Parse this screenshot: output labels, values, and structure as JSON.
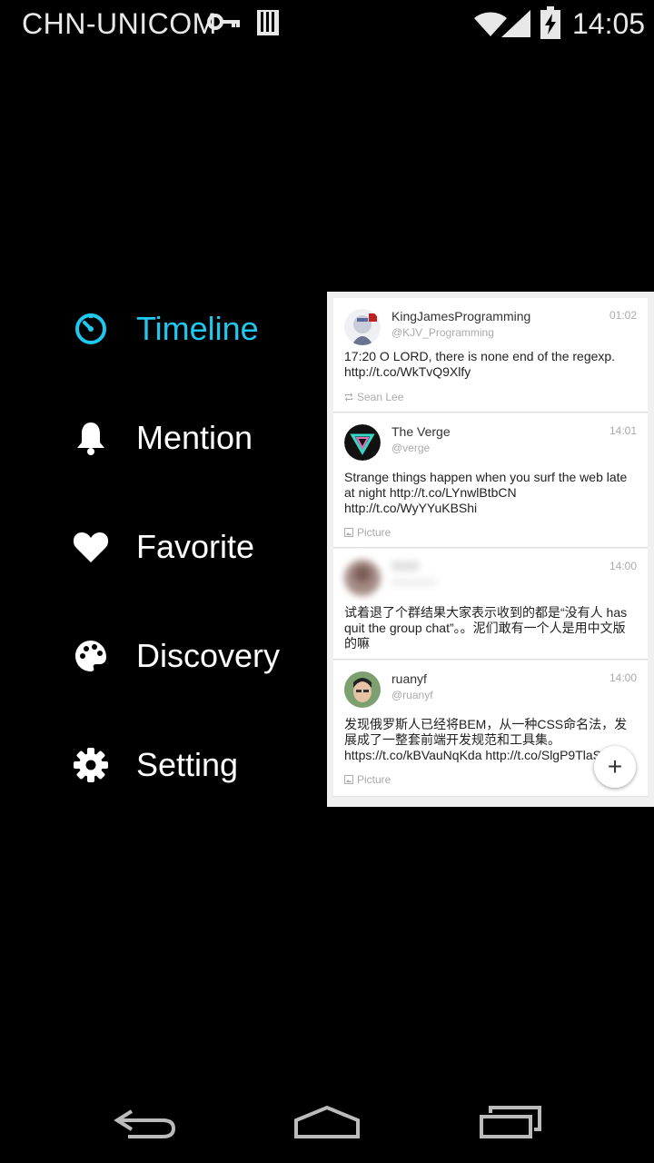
{
  "status_bar": {
    "carrier": "CHN-UNICOM",
    "time": "14:05",
    "icons": [
      "vpn-key-icon",
      "sd-card-icon",
      "wifi-icon",
      "signal-icon",
      "battery-charging-icon"
    ]
  },
  "menu": {
    "accent_color": "#1ec8ee",
    "items": [
      {
        "label": "Timeline",
        "icon": "timeline-icon",
        "active": true
      },
      {
        "label": "Mention",
        "icon": "bell-icon",
        "active": false
      },
      {
        "label": "Favorite",
        "icon": "heart-icon",
        "active": false
      },
      {
        "label": "Discovery",
        "icon": "palette-icon",
        "active": false
      },
      {
        "label": "Setting",
        "icon": "gear-icon",
        "active": false
      }
    ]
  },
  "timeline": {
    "tweets": [
      {
        "name": "KingJamesProgramming",
        "handle": "@KJV_Programming",
        "time": "01:02",
        "text": "17:20 O LORD, there is none end of the regexp. http://t.co/WkTvQ9Xlfy",
        "meta": "Sean Lee",
        "meta_icon": "retweet-icon"
      },
      {
        "name": "The Verge",
        "handle": "@verge",
        "time": "14:01",
        "text": "Strange things happen when you surf the web late at night http://t.co/LYnwlBtbCN http://t.co/WyYYuKBShi",
        "meta": "Picture",
        "meta_icon": "picture-icon"
      },
      {
        "name": "",
        "handle": "",
        "time": "14:00",
        "text": "试着退了个群结果大家表示收到的都是“没有人 has quit the group chat”。。泥们敢有一个人是用中文版的嘛",
        "meta": "",
        "meta_icon": ""
      },
      {
        "name": "ruanyf",
        "handle": "@ruanyf",
        "time": "14:00",
        "text": "发现俄罗斯人已经将BEM，从一种CSS命名法，发展成了一整套前端开发规范和工具集。 https://t.co/kBVauNqKda http://t.co/SlgP9TlaSe",
        "meta": "Picture",
        "meta_icon": "picture-icon"
      }
    ],
    "fab_label": "+"
  },
  "nav_bar": {
    "buttons": [
      "back-icon",
      "home-icon",
      "recents-icon"
    ]
  }
}
